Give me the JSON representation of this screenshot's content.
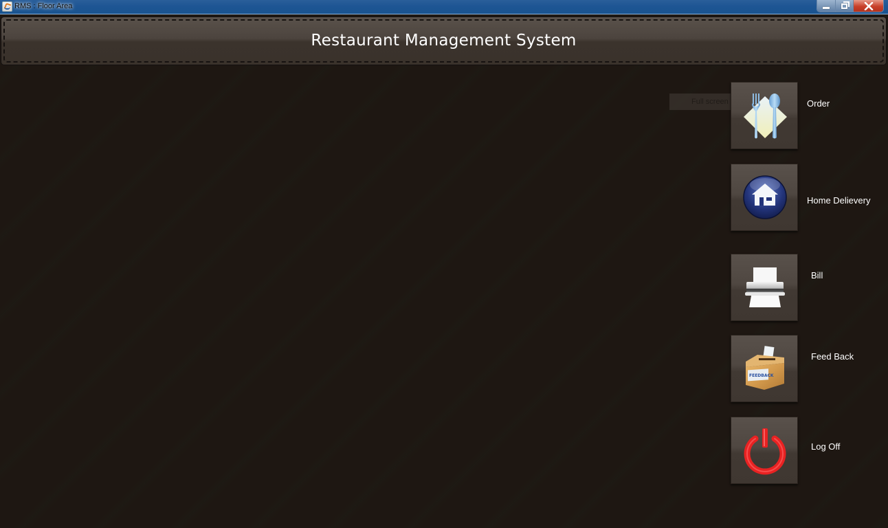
{
  "window": {
    "title": "RMS : Floor Area",
    "controls": {
      "minimize": "minimize",
      "maximize": "restore",
      "close": "close"
    }
  },
  "header": {
    "title": "Restaurant Management System"
  },
  "tooltip": {
    "text": "Full screen"
  },
  "menu": {
    "items": [
      {
        "label": "Order",
        "icon": "cutlery-icon"
      },
      {
        "label": "Home Delievery",
        "icon": "home-icon"
      },
      {
        "label": "Bill",
        "icon": "printer-icon"
      },
      {
        "label": "Feed Back",
        "icon": "feedback-box-icon"
      },
      {
        "label": "Log Off",
        "icon": "power-icon"
      }
    ]
  },
  "colors": {
    "background": "#1e1712",
    "header": "#4c443e",
    "titlebar": "#1d5593",
    "power_red": "#e82222",
    "home_blue": "#23347a"
  }
}
